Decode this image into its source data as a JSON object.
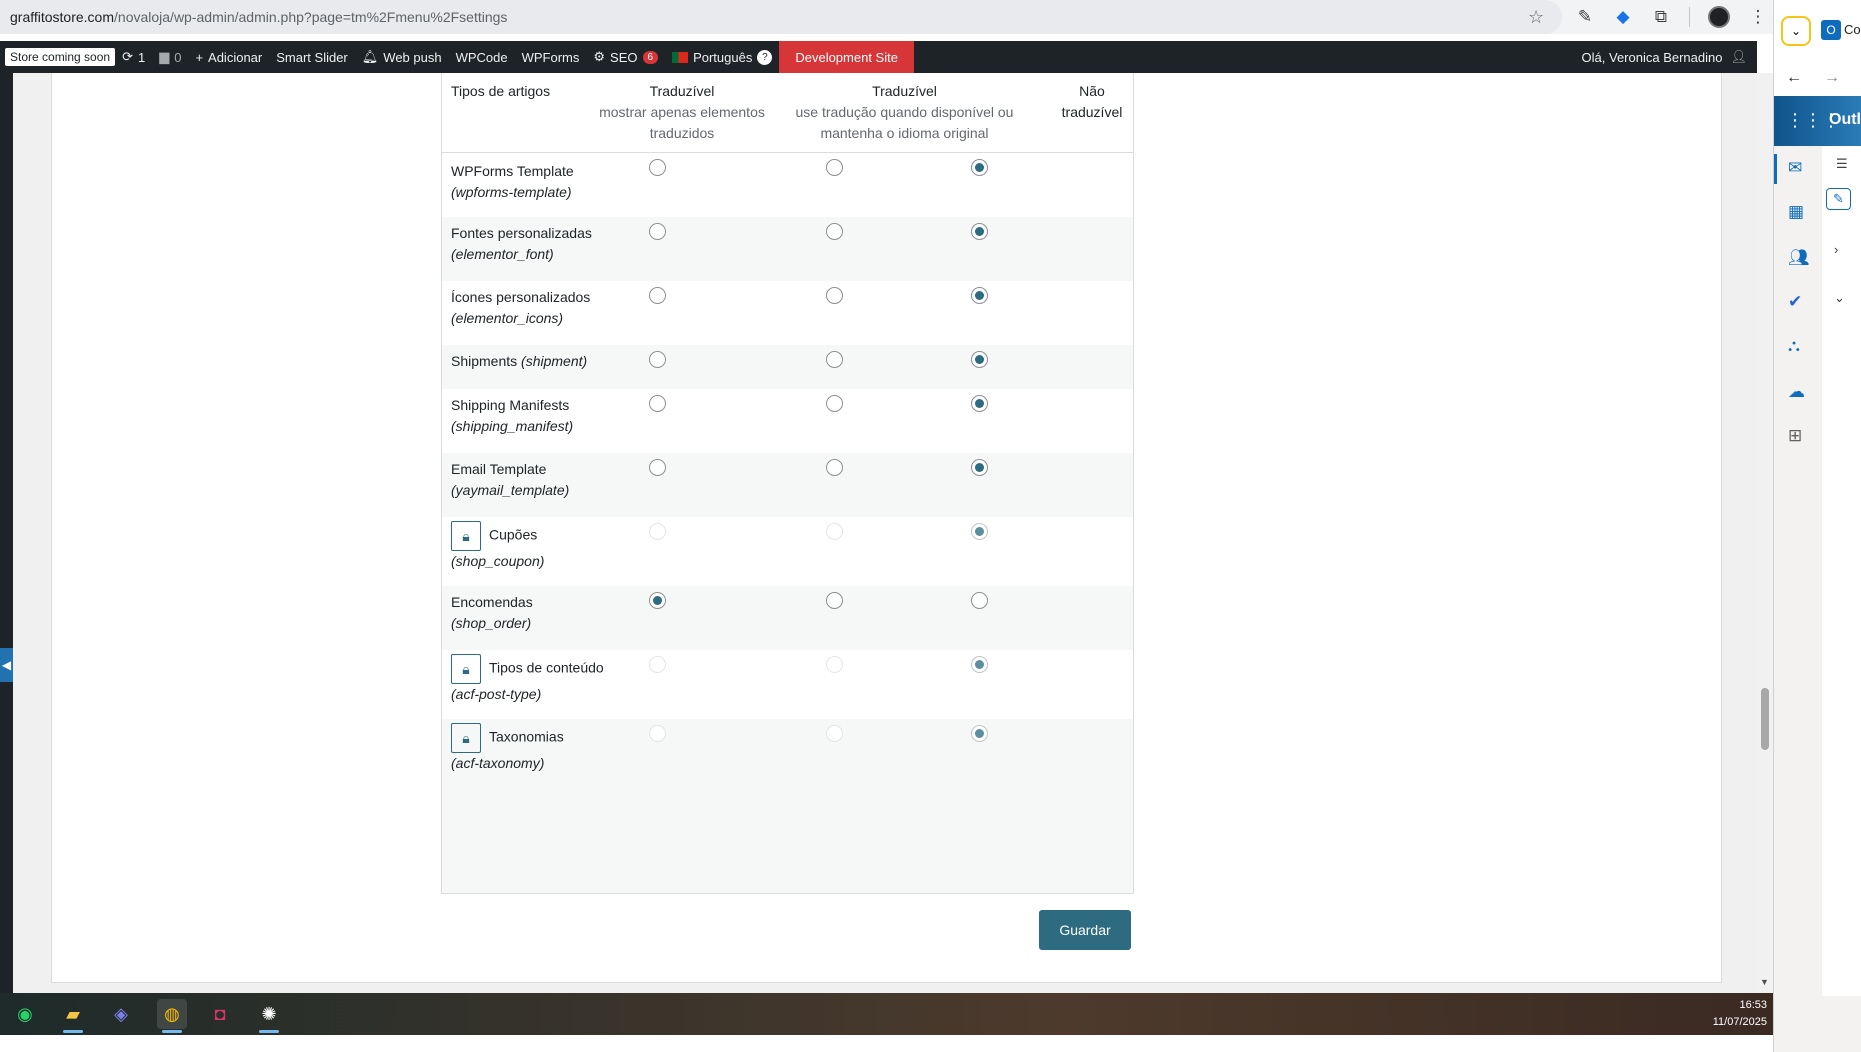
{
  "browser": {
    "url_domain": "graffitostore.com",
    "url_path": "/novaloja/wp-admin/admin.php?page=tm%2Fmenu%2Fsettings"
  },
  "admin_bar": {
    "store_label": "Store coming soon",
    "updates_count": "1",
    "comments_count": "0",
    "add_label": "Adicionar",
    "smart_slider": "Smart Slider",
    "web_push": "Web push",
    "wpcode": "WPCode",
    "wpforms": "WPForms",
    "seo_label": "SEO",
    "seo_badge": "6",
    "language_label": "Português",
    "help_badge": "?",
    "dev_site": "Development Site",
    "greeting": "Olá, Veronica Bernadino"
  },
  "table": {
    "headers": {
      "type": "Tipos de artigos",
      "translatable_only": "Traduzível",
      "translatable_only_sub": "mostrar apenas elementos traduzidos",
      "translatable_fallback": "Traduzível",
      "translatable_fallback_sub": "use tradução quando disponível ou mantenha o idioma original",
      "not_translatable": "Não traduzível"
    },
    "rows": [
      {
        "name": "WPForms Template",
        "slug": "(wpforms-template)",
        "locked": false,
        "selected": 3
      },
      {
        "name": "Fontes personalizadas",
        "slug": "(elementor_font)",
        "locked": false,
        "selected": 3
      },
      {
        "name": "Ícones personalizados",
        "slug": "(elementor_icons)",
        "locked": false,
        "selected": 3
      },
      {
        "name": "Shipments",
        "slug": "(shipment)",
        "locked": false,
        "selected": 3
      },
      {
        "name": "Shipping Manifests",
        "slug": "(shipping_manifest)",
        "locked": false,
        "selected": 3
      },
      {
        "name": "Email Template",
        "slug": "(yaymail_template)",
        "locked": false,
        "selected": 3
      },
      {
        "name": "Cupões",
        "slug": "(shop_coupon)",
        "locked": true,
        "selected": 3
      },
      {
        "name": "Encomendas",
        "slug": "(shop_order)",
        "locked": false,
        "selected": 1
      },
      {
        "name": "Tipos de conteúdo",
        "slug": "(acf-post-type)",
        "locked": true,
        "selected": 3
      },
      {
        "name": "Taxonomias",
        "slug": "(acf-taxonomy)",
        "locked": true,
        "selected": 3
      }
    ]
  },
  "save_label": "Guardar",
  "side_panel": {
    "tab_text": "Co",
    "app_title": "Outl"
  },
  "taskbar": {
    "time": "16:53",
    "date": "11/07/2025"
  },
  "colors": {
    "accent": "#2c6b80",
    "admin_bar": "#1d2327",
    "dev_site": "#d63638"
  }
}
